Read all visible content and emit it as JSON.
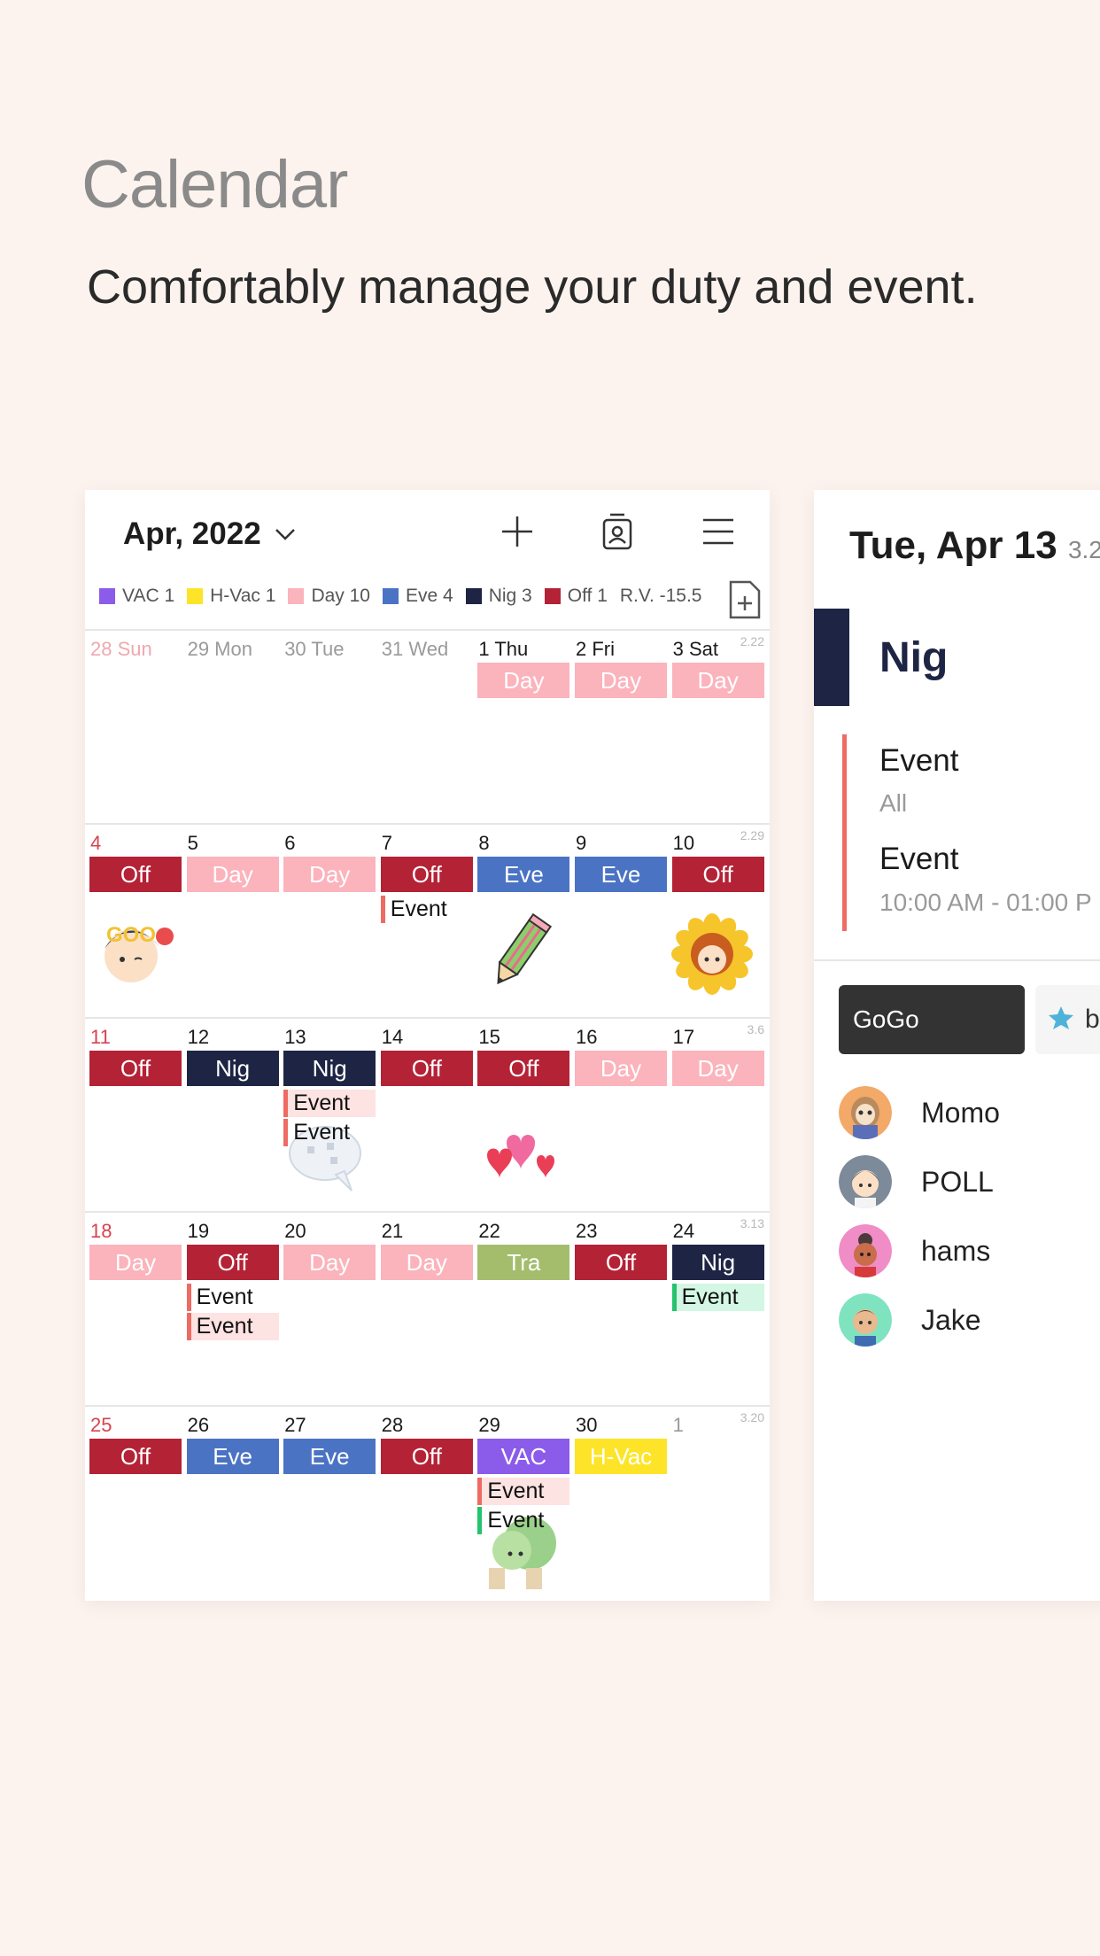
{
  "hero": {
    "title": "Calendar",
    "subtitle": "Comfortably manage your duty and event."
  },
  "calendar": {
    "month_label": "Apr, 2022",
    "header_icons": [
      "chevron-down-icon",
      "plus-icon",
      "id-badge-icon",
      "menu-icon"
    ],
    "legend": [
      {
        "label": "VAC 1",
        "color": "#8b5bea"
      },
      {
        "label": "H-Vac 1",
        "color": "#fde428"
      },
      {
        "label": "Day 10",
        "color": "#fbb3bc"
      },
      {
        "label": "Eve 4",
        "color": "#4b73c4"
      },
      {
        "label": "Nig 3",
        "color": "#1e2544"
      },
      {
        "label": "Off 1",
        "color": "#b42236"
      },
      {
        "label": "R.V. -15.5",
        "color": ""
      }
    ],
    "weeks": [
      {
        "rv": "2.22",
        "days": [
          {
            "num": "28 Sun",
            "sun": true,
            "other": true
          },
          {
            "num": "29 Mon",
            "other": true
          },
          {
            "num": "30 Tue",
            "other": true
          },
          {
            "num": "31 Wed",
            "other": true
          },
          {
            "num": "1 Thu",
            "duty": "Day",
            "color": "#fbb3bc"
          },
          {
            "num": "2 Fri",
            "duty": "Day",
            "color": "#fbb3bc"
          },
          {
            "num": "3 Sat",
            "duty": "Day",
            "color": "#fbb3bc"
          }
        ]
      },
      {
        "rv": "2.29",
        "days": [
          {
            "num": "4",
            "sun": true,
            "duty": "Off",
            "color": "#b42236",
            "sticker": "good-boy-sticker"
          },
          {
            "num": "5",
            "duty": "Day",
            "color": "#fbb3bc"
          },
          {
            "num": "6",
            "duty": "Day",
            "color": "#fbb3bc"
          },
          {
            "num": "7",
            "duty": "Off",
            "color": "#b42236",
            "events": [
              {
                "label": "Event",
                "style": "red",
                "bg": ""
              }
            ]
          },
          {
            "num": "8",
            "duty": "Eve",
            "color": "#4b73c4",
            "sticker": "pencil-sticker"
          },
          {
            "num": "9",
            "duty": "Eve",
            "color": "#4b73c4"
          },
          {
            "num": "10",
            "duty": "Off",
            "color": "#b42236",
            "sticker": "sunflower-sticker"
          }
        ]
      },
      {
        "rv": "3.6",
        "days": [
          {
            "num": "11",
            "sun": true,
            "duty": "Off",
            "color": "#b42236"
          },
          {
            "num": "12",
            "duty": "Nig",
            "color": "#1e2544"
          },
          {
            "num": "13",
            "duty": "Nig",
            "color": "#1e2544",
            "sticker": "speech-bubble-sticker",
            "events": [
              {
                "label": "Event",
                "style": "red",
                "bg": "#fde3e2"
              },
              {
                "label": "Event",
                "style": "red",
                "bg": ""
              }
            ]
          },
          {
            "num": "14",
            "duty": "Off",
            "color": "#b42236"
          },
          {
            "num": "15",
            "duty": "Off",
            "color": "#b42236",
            "sticker": "hearts-sticker"
          },
          {
            "num": "16",
            "duty": "Day",
            "color": "#fbb3bc"
          },
          {
            "num": "17",
            "duty": "Day",
            "color": "#fbb3bc"
          }
        ]
      },
      {
        "rv": "3.13",
        "days": [
          {
            "num": "18",
            "sun": true,
            "duty": "Day",
            "color": "#fbb3bc"
          },
          {
            "num": "19",
            "duty": "Off",
            "color": "#b42236",
            "events": [
              {
                "label": "Event",
                "style": "red",
                "bg": ""
              },
              {
                "label": "Event",
                "style": "red",
                "bg": "#fde3e2"
              }
            ]
          },
          {
            "num": "20",
            "duty": "Day",
            "color": "#fbb3bc"
          },
          {
            "num": "21",
            "duty": "Day",
            "color": "#fbb3bc"
          },
          {
            "num": "22",
            "duty": "Tra",
            "color": "#a4bd6d"
          },
          {
            "num": "23",
            "duty": "Off",
            "color": "#b42236"
          },
          {
            "num": "24",
            "duty": "Nig",
            "color": "#1e2544",
            "events": [
              {
                "label": "Event",
                "style": "green",
                "bg": "#d3f7e4"
              }
            ]
          }
        ]
      },
      {
        "rv": "3.20",
        "days": [
          {
            "num": "25",
            "sun": true,
            "duty": "Off",
            "color": "#b42236"
          },
          {
            "num": "26",
            "duty": "Eve",
            "color": "#4b73c4"
          },
          {
            "num": "27",
            "duty": "Eve",
            "color": "#4b73c4"
          },
          {
            "num": "28",
            "duty": "Off",
            "color": "#b42236"
          },
          {
            "num": "29",
            "duty": "VAC",
            "color": "#8b5bea",
            "sticker": "tree-sticker",
            "events": [
              {
                "label": "Event",
                "style": "red",
                "bg": "#fde3e2"
              },
              {
                "label": "Event",
                "style": "green",
                "bg": ""
              }
            ]
          },
          {
            "num": "30",
            "duty": "H-Vac",
            "color": "#fde428"
          },
          {
            "num": "1",
            "other": true
          }
        ]
      }
    ]
  },
  "detail": {
    "date": "Tue, Apr 13",
    "date_extra": "3.2",
    "duty": "Nig",
    "duty_color": "#1e2544",
    "events": [
      {
        "title": "Event",
        "sub": "All"
      },
      {
        "title": "Event",
        "sub": "10:00 AM - 01:00 P"
      }
    ],
    "chips": [
      {
        "label": "GoGo"
      },
      {
        "label": "b",
        "icon": "star-icon"
      }
    ],
    "users": [
      {
        "name": "Momo",
        "avatar": "sloth-avatar"
      },
      {
        "name": "POLL",
        "avatar": "boy-avatar"
      },
      {
        "name": "hams",
        "avatar": "girl-avatar"
      },
      {
        "name": "Jake",
        "avatar": "man-avatar"
      }
    ]
  }
}
